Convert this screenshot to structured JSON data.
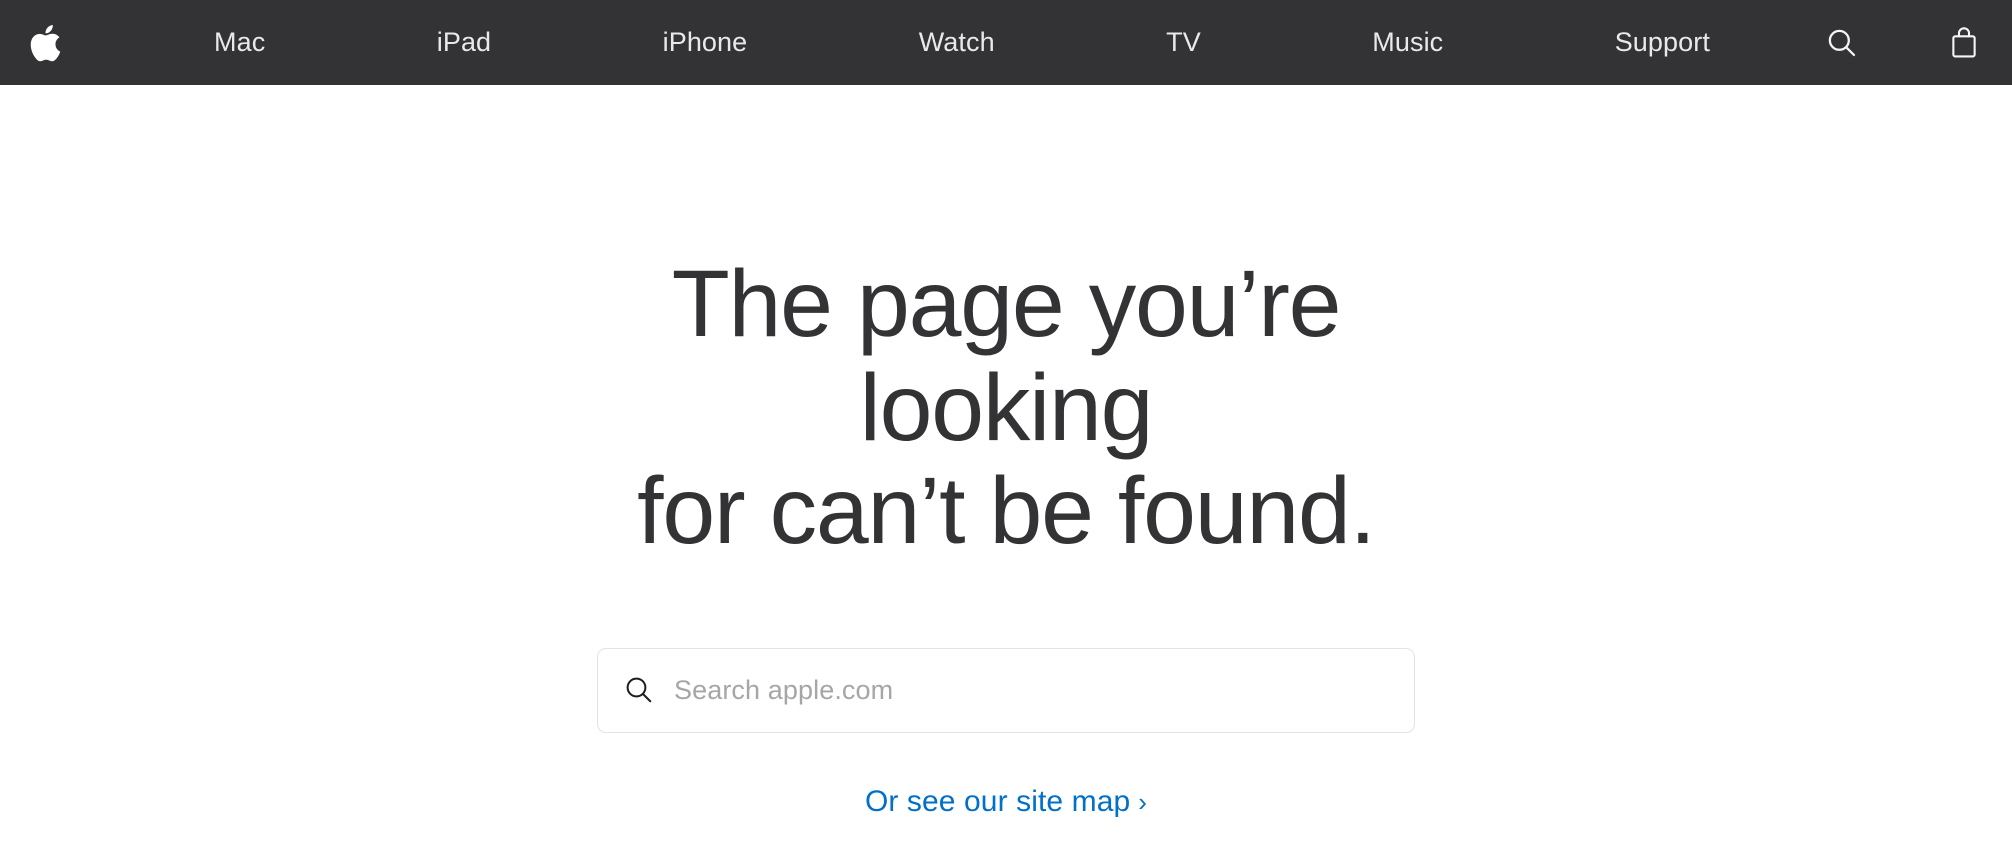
{
  "globalnav": {
    "logo": {
      "name": "apple-logo",
      "aria_label": "Apple"
    },
    "items": [
      {
        "label": "Mac"
      },
      {
        "label": "iPad"
      },
      {
        "label": "iPhone"
      },
      {
        "label": "Watch"
      },
      {
        "label": "TV"
      },
      {
        "label": "Music"
      },
      {
        "label": "Support"
      }
    ],
    "search_icon": "search-icon",
    "bag_icon": "shopping-bag-icon",
    "background_color": "#333336",
    "text_color": "#f5f5f7"
  },
  "main": {
    "heading_line1": "The page you’re looking",
    "heading_line2": "for can’t be found.",
    "heading_color": "#333336",
    "search": {
      "icon": "search-icon",
      "placeholder": "Search apple.com",
      "value": ""
    },
    "sitemap": {
      "label": "Or see our site map",
      "chevron": "›",
      "color": "#0070c9"
    }
  },
  "page": {
    "background_color": "#ffffff"
  }
}
